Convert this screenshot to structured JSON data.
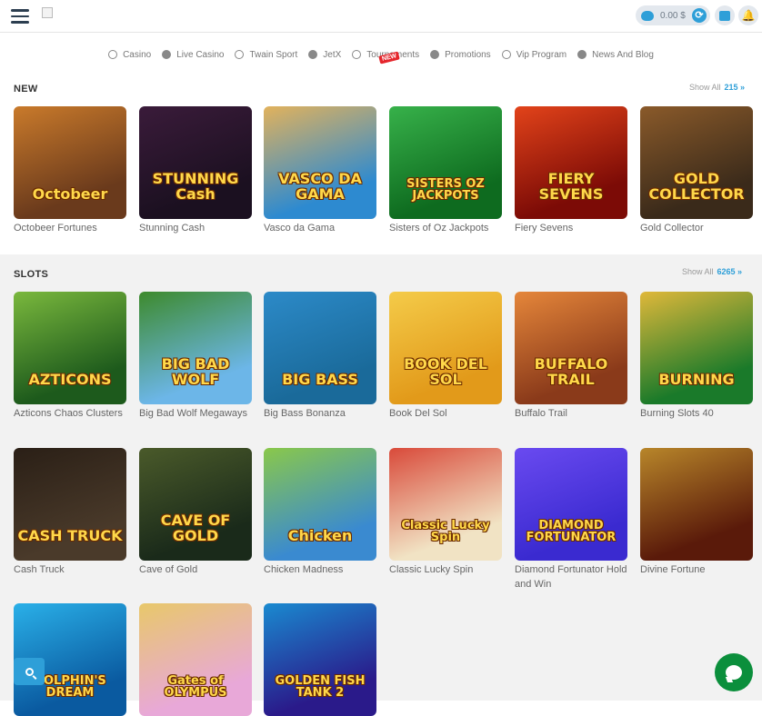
{
  "header": {
    "balance": "0.00 $",
    "icons": [
      "menu-icon",
      "piggy-bank-icon",
      "refresh-icon",
      "wallet-icon",
      "bell-icon"
    ]
  },
  "nav": {
    "items": [
      {
        "label": "Casino",
        "icon": "casino-icon"
      },
      {
        "label": "Live Casino",
        "icon": "live-casino-icon"
      },
      {
        "label": "Twain Sport",
        "icon": "sport-icon"
      },
      {
        "label": "JetX",
        "icon": "jetx-icon"
      },
      {
        "label": "Tournaments",
        "icon": "trophy-icon",
        "badge": "NEW"
      },
      {
        "label": "Promotions",
        "icon": "gift-icon"
      },
      {
        "label": "Vip Program",
        "icon": "crown-icon"
      },
      {
        "label": "News And Blog",
        "icon": "news-icon"
      }
    ]
  },
  "new_section": {
    "title": "NEW",
    "show_all": "Show All",
    "count": "215 »",
    "games": [
      {
        "name": "Octobeer Fortunes",
        "art": "Octobeer",
        "bg": "#6a3a1c",
        "bg2": "#c97a2b"
      },
      {
        "name": "Stunning Cash",
        "art": "STUNNING Cash",
        "bg": "#1b1020",
        "bg2": "#3a1b3a"
      },
      {
        "name": "Vasco da Gama",
        "art": "VASCO DA GAMA",
        "bg": "#2d8ad0",
        "bg2": "#e2b25c"
      },
      {
        "name": "Sisters of Oz Jackpots",
        "art": "SISTERS OZ JACKPOTS",
        "bg": "#0e6b1f",
        "bg2": "#37b14a"
      },
      {
        "name": "Fiery Sevens",
        "art": "FIERY SEVENS",
        "bg": "#7c0b06",
        "bg2": "#e2431a"
      },
      {
        "name": "Gold Collector",
        "art": "GOLD COLLECTOR",
        "bg": "#3a2a1a",
        "bg2": "#8a5a2a"
      }
    ]
  },
  "slots_section": {
    "title": "SLOTS",
    "show_all": "Show All",
    "count": "6265 »",
    "games": [
      {
        "name": "Azticons Chaos Clusters",
        "art": "AZTICONS",
        "bg": "#1d5a1c",
        "bg2": "#7ab83d"
      },
      {
        "name": "Big Bad Wolf Megaways",
        "art": "BIG BAD WOLF",
        "bg": "#6cb6e8",
        "bg2": "#3d8a2c"
      },
      {
        "name": "Big Bass Bonanza",
        "art": "BIG BASS",
        "bg": "#1a6a9a",
        "bg2": "#2c8ac8"
      },
      {
        "name": "Book Del Sol",
        "art": "BOOK DEL SOL",
        "bg": "#e29a1a",
        "bg2": "#f4cb49"
      },
      {
        "name": "Buffalo Trail",
        "art": "BUFFALO TRAIL",
        "bg": "#8a3a1a",
        "bg2": "#e5863a"
      },
      {
        "name": "Burning Slots 40",
        "art": "BURNING",
        "bg": "#1a7a2a",
        "bg2": "#e0b83a"
      },
      {
        "name": "Cash Truck",
        "art": "CASH TRUCK",
        "bg": "#4a3a2a",
        "bg2": "#2a1f16"
      },
      {
        "name": "Cave of Gold",
        "art": "CAVE OF GOLD",
        "bg": "#1a2a1a",
        "bg2": "#4a5a2a"
      },
      {
        "name": "Chicken Madness",
        "art": "Chicken",
        "bg": "#3a8ad0",
        "bg2": "#8ac84a"
      },
      {
        "name": "Classic Lucky Spin",
        "art": "Classic Lucky Spin",
        "bg": "#f1e3c4",
        "bg2": "#d94a3a"
      },
      {
        "name": "Diamond Fortunator Hold and Win",
        "art": "DIAMOND FORTUNATOR",
        "bg": "#3a2ad0",
        "bg2": "#6a4af0"
      },
      {
        "name": "Divine Fortune",
        "art": "",
        "bg": "#5a1a0a",
        "bg2": "#b8862a"
      },
      {
        "name": "",
        "art": "DOLPHIN'S DREAM",
        "bg": "#0a5aa0",
        "bg2": "#2ab0e8"
      },
      {
        "name": "",
        "art": "Gates of OLYMPUS",
        "bg": "#e8a8d8",
        "bg2": "#e8c86a"
      },
      {
        "name": "",
        "art": "GOLDEN FISH TANK 2",
        "bg": "#2a1a8a",
        "bg2": "#1a8ad0"
      }
    ]
  },
  "fabs": {
    "search_icon": "search-icon",
    "chat_icon": "chat-icon"
  }
}
